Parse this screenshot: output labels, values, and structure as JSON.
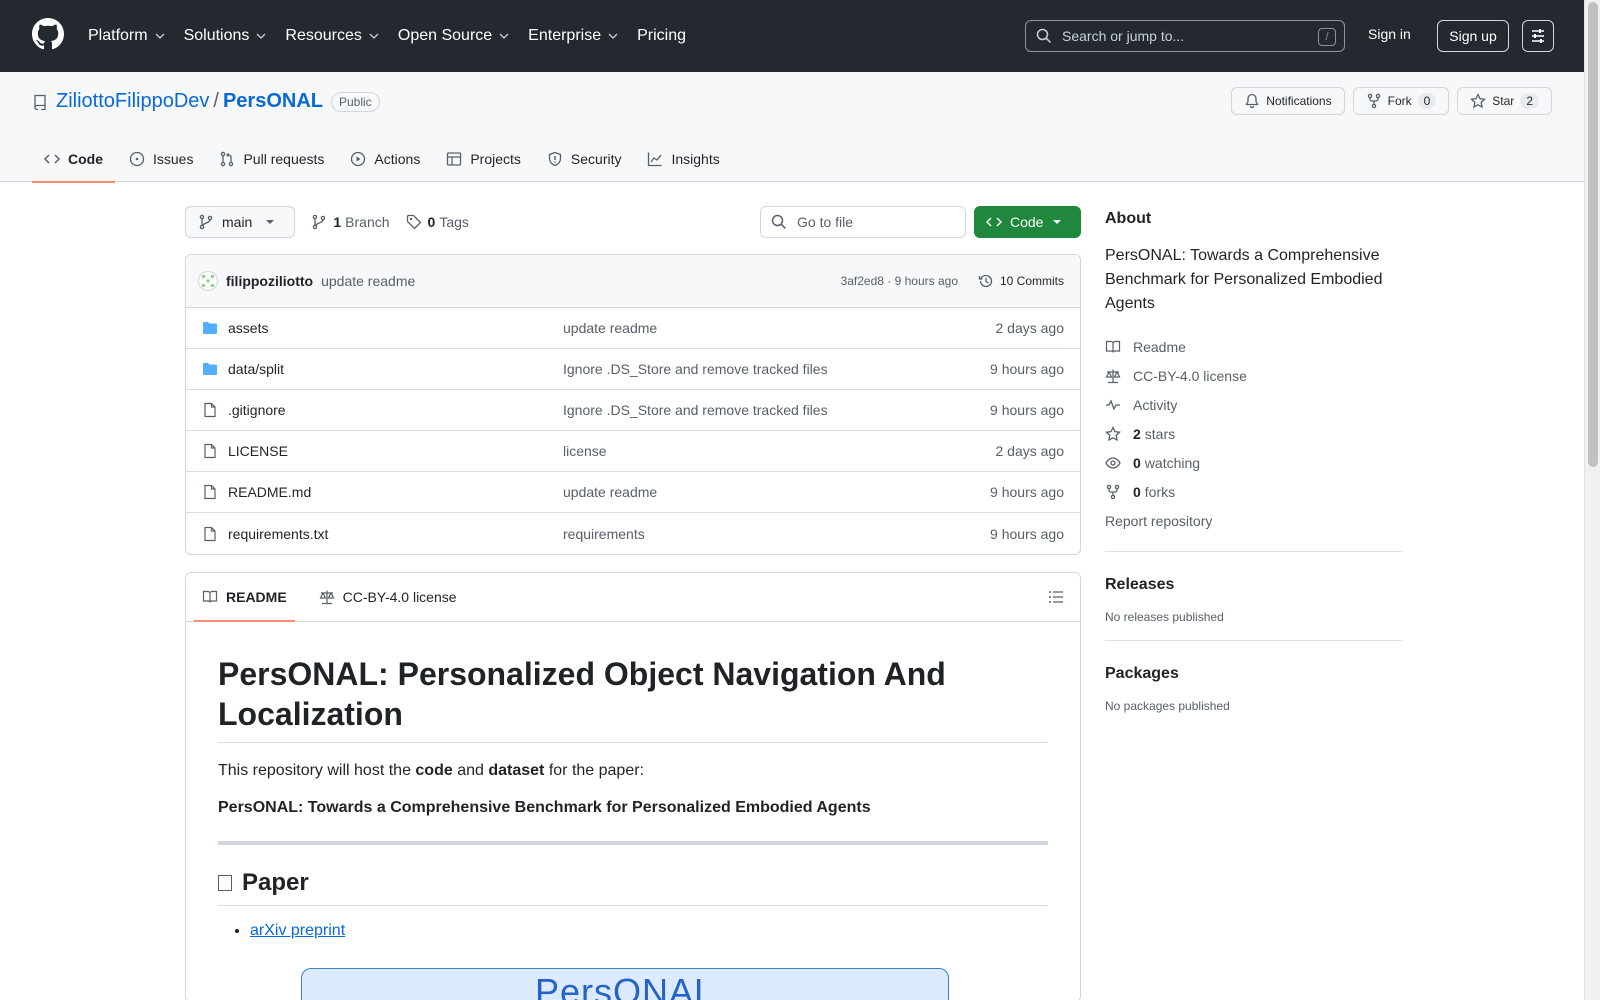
{
  "header": {
    "nav": [
      "Platform",
      "Solutions",
      "Resources",
      "Open Source",
      "Enterprise",
      "Pricing"
    ],
    "search_placeholder": "Search or jump to...",
    "search_shortcut": "/",
    "signin": "Sign in",
    "signup": "Sign up"
  },
  "repo": {
    "owner": "ZiliottoFilippoDev",
    "separator": "/",
    "name": "PersONAL",
    "visibility": "Public",
    "notifications_label": "Notifications",
    "fork_label": "Fork",
    "fork_count": "0",
    "star_label": "Star",
    "star_count": "2",
    "tabs": [
      "Code",
      "Issues",
      "Pull requests",
      "Actions",
      "Projects",
      "Security",
      "Insights"
    ]
  },
  "toolbar": {
    "branch": "main",
    "branch_count": "1",
    "branch_label": "Branch",
    "tag_count": "0",
    "tag_label": "Tags",
    "goto_placeholder": "Go to file",
    "code_label": "Code"
  },
  "commit": {
    "author": "filippoziliotto",
    "message": "update readme",
    "meta": "3af2ed8 · 9 hours ago",
    "commits_label": "10 Commits"
  },
  "files": [
    {
      "name": "assets",
      "type": "dir",
      "message": "update readme",
      "date": "2 days ago"
    },
    {
      "name": "data/split",
      "type": "dir",
      "message": "Ignore .DS_Store and remove tracked files",
      "date": "9 hours ago"
    },
    {
      "name": ".gitignore",
      "type": "file",
      "message": "Ignore .DS_Store and remove tracked files",
      "date": "9 hours ago"
    },
    {
      "name": "LICENSE",
      "type": "file",
      "message": "license",
      "date": "2 days ago"
    },
    {
      "name": "README.md",
      "type": "file",
      "message": "update readme",
      "date": "9 hours ago"
    },
    {
      "name": "requirements.txt",
      "type": "file",
      "message": "requirements",
      "date": "9 hours ago"
    }
  ],
  "readme": {
    "tab_readme": "README",
    "tab_license": "CC-BY-4.0 license",
    "h1": "PersONAL: Personalized Object Navigation And Localization",
    "intro_before": "This repository will host the ",
    "intro_code": "code",
    "intro_and": " and ",
    "intro_dataset": "dataset",
    "intro_after": " for the paper:",
    "paper_title": "PersONAL: Towards a Comprehensive Benchmark for Personalized Embodied Agents",
    "h2": "Paper",
    "link": "arXiv preprint",
    "banner": "PersONAL"
  },
  "sidebar": {
    "about_title": "About",
    "description": "PersONAL: Towards a Comprehensive Benchmark for Personalized Embodied Agents",
    "readme": "Readme",
    "license": "CC-BY-4.0 license",
    "activity": "Activity",
    "stars_count": "2",
    "stars_label": "stars",
    "watching_count": "0",
    "watching_label": "watching",
    "forks_count": "0",
    "forks_label": "forks",
    "report": "Report repository",
    "releases_title": "Releases",
    "releases_empty": "No releases published",
    "packages_title": "Packages",
    "packages_empty": "No packages published"
  },
  "colors": {
    "header_bg": "#24292f",
    "link": "#0969da",
    "primary_button": "#1f883d",
    "tab_underline": "#fd8c73",
    "folder": "#54aeff"
  }
}
